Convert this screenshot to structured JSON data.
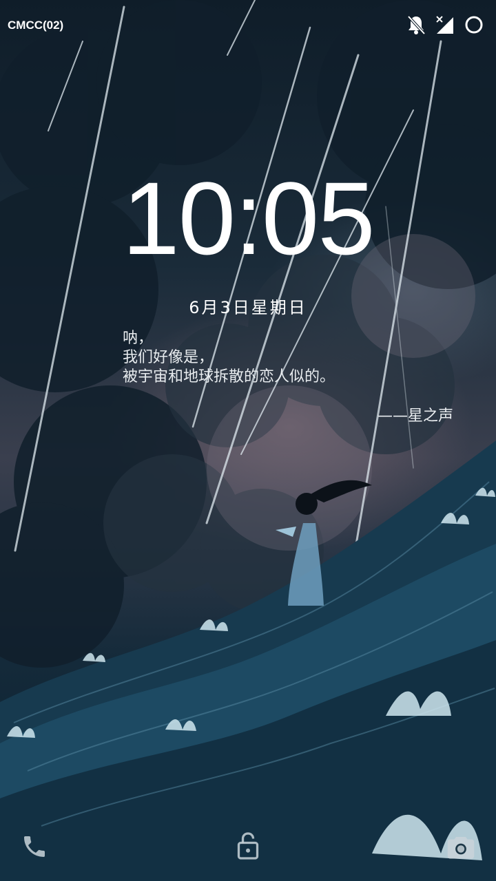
{
  "status_bar": {
    "carrier": "CMCC(02)",
    "icons": [
      "notifications-off-icon",
      "no-signal-icon",
      "circle-icon"
    ]
  },
  "lock_screen": {
    "time": "10:05",
    "date": "6月3日星期日",
    "quote_lines": [
      "呐，",
      "我们好像是，",
      "被宇宙和地球拆散的恋人似的。"
    ],
    "quote_author": "——星之声"
  },
  "bottom_shortcuts": [
    "phone-icon",
    "unlock-icon",
    "camera-icon"
  ],
  "colors": {
    "text": "#ffffff",
    "wave": "#1d4a63",
    "flower": "#cfe6ef"
  }
}
